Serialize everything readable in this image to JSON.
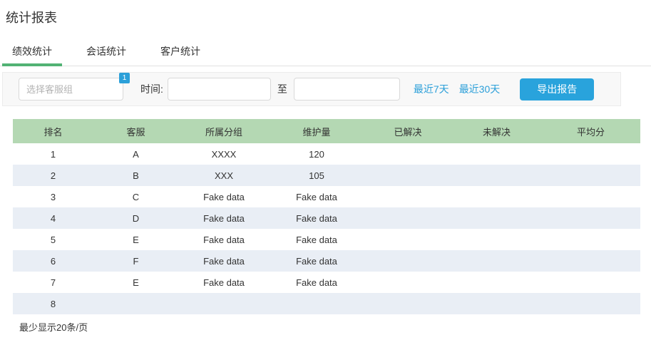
{
  "page": {
    "title": "统计报表"
  },
  "tabs": [
    {
      "label": "绩效统计",
      "active": true
    },
    {
      "label": "会话统计",
      "active": false
    },
    {
      "label": "客户统计",
      "active": false
    }
  ],
  "filters": {
    "group_select": {
      "placeholder": "选择客服组",
      "value": "",
      "badge": "1"
    },
    "time_label": "时间:",
    "date_from": "",
    "to_label": "至",
    "date_to": "",
    "quick_links": [
      "最近7天",
      "最近30天"
    ],
    "export_button": "导出报告"
  },
  "table": {
    "headers": [
      "排名",
      "客服",
      "所属分组",
      "维护量",
      "已解决",
      "未解决",
      "平均分"
    ],
    "rows": [
      [
        "1",
        "A",
        "XXXX",
        "120",
        "",
        "",
        ""
      ],
      [
        "2",
        "B",
        "XXX",
        "105",
        "",
        "",
        ""
      ],
      [
        "3",
        "C",
        "Fake data",
        "Fake data",
        "",
        "",
        ""
      ],
      [
        "4",
        "D",
        "Fake data",
        "Fake data",
        "",
        "",
        ""
      ],
      [
        "5",
        "E",
        "Fake data",
        "Fake data",
        "",
        "",
        ""
      ],
      [
        "6",
        "F",
        "Fake data",
        "Fake data",
        "",
        "",
        ""
      ],
      [
        "7",
        "E",
        "Fake data",
        "Fake data",
        "",
        "",
        ""
      ],
      [
        "8",
        "",
        "",
        "",
        "",
        "",
        ""
      ]
    ]
  },
  "footer": {
    "page_size_note": "最少显示20条/页"
  },
  "colors": {
    "accent_blue": "#2ba0d9",
    "button_blue": "#29a3dc",
    "tab_underline_green": "#52b274",
    "table_header_green": "#b4d8b3",
    "row_stripe": "#e9eef5"
  }
}
